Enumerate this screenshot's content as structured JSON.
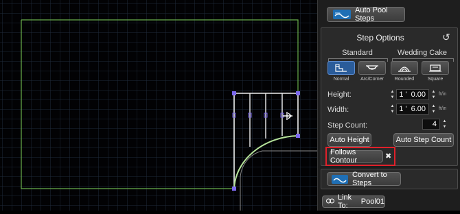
{
  "panel": {
    "auto_pool_steps_label": "Auto Pool Steps",
    "step_options_title": "Step Options",
    "groups": {
      "standard": "Standard",
      "wedding_cake": "Wedding Cake"
    },
    "step_types": [
      {
        "label": "Normal",
        "icon": "step-normal-icon",
        "selected": true
      },
      {
        "label": "Arc/Corner",
        "icon": "step-arc-icon",
        "selected": false
      },
      {
        "label": "Rounded",
        "icon": "step-rounded-icon",
        "selected": false
      },
      {
        "label": "Square",
        "icon": "step-square-icon",
        "selected": false
      }
    ],
    "height": {
      "label": "Height:",
      "feet": "1",
      "inches": "0.00",
      "unit": "ft/in"
    },
    "width": {
      "label": "Width:",
      "feet": "1",
      "inches": "6.00",
      "unit": "ft/in"
    },
    "step_count": {
      "label": "Step Count:",
      "value": "4"
    },
    "auto_height_label": "Auto Height",
    "auto_step_count_label": "Auto Step Count",
    "follows_contour_label": "Follows Contour",
    "remove_glyph": "✖",
    "convert_label": "Convert to Steps",
    "link_to_label": "Link To:",
    "link_to_value": "Pool01",
    "reset_glyph": "↺",
    "apostrophe": "'"
  },
  "colors": {
    "pool_outline": "#6ab04c",
    "handle": "#7b68ee",
    "highlight": "#e0202a",
    "selected_button": "#2a5c9a"
  }
}
